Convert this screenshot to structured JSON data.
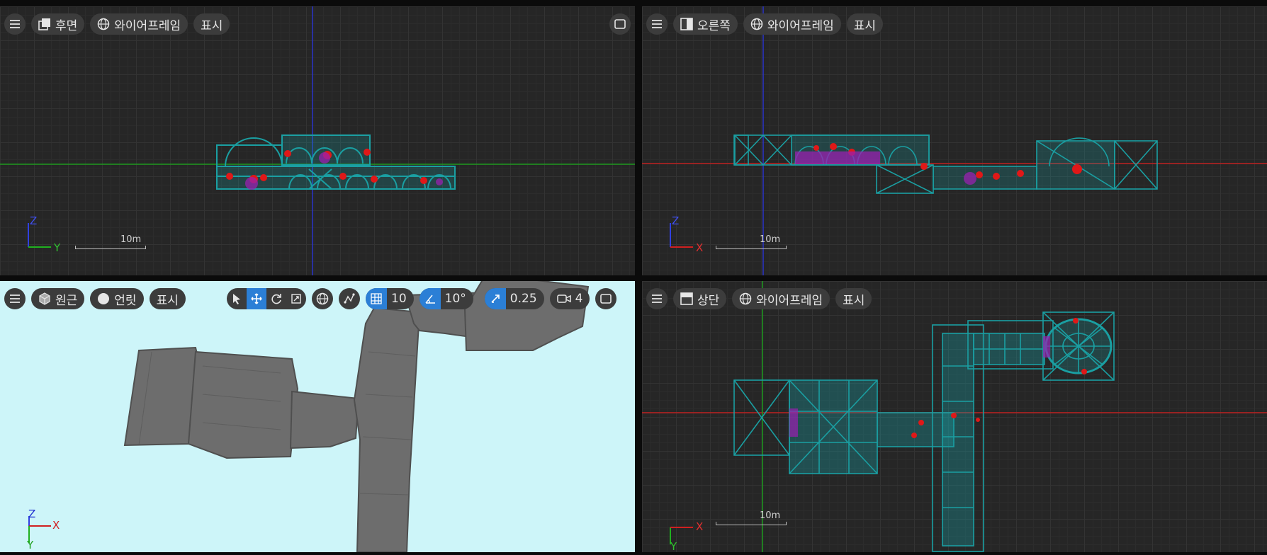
{
  "viewports": {
    "back": {
      "view_label": "후면",
      "shading_label": "와이어프레임",
      "show_label": "표시",
      "gizmo": {
        "up": "Z",
        "right": "Y"
      },
      "scale": "10m"
    },
    "right": {
      "view_label": "오른쪽",
      "shading_label": "와이어프레임",
      "show_label": "표시",
      "gizmo": {
        "up": "Z",
        "right": "X"
      },
      "scale": "10m"
    },
    "perspective": {
      "view_label": "원근",
      "shading_label": "언릿",
      "show_label": "표시",
      "grid_snap": "10",
      "rotation_snap": "10°",
      "scale_snap": "0.25",
      "camera_speed": "4",
      "gizmo": {
        "up": "Z",
        "right": "X",
        "forward": "Y"
      }
    },
    "top": {
      "view_label": "상단",
      "shading_label": "와이어프레임",
      "show_label": "표시",
      "gizmo": {
        "up": "Y",
        "right": "X"
      },
      "scale": "10m"
    }
  },
  "colors": {
    "wireframe": "#1a9fa2",
    "axis_x": "#d02020",
    "axis_y": "#20b020",
    "axis_z": "#3040e0",
    "active": "#2b7fd6"
  },
  "icons": {
    "menu": "hamburger-icon",
    "view_back": "back-view-icon",
    "view_right": "right-view-icon",
    "view_top": "top-view-icon",
    "view_persp": "cube-icon",
    "shading_wire": "globe-icon",
    "shading_unlit": "circle-icon",
    "maximize": "maximize-icon"
  }
}
